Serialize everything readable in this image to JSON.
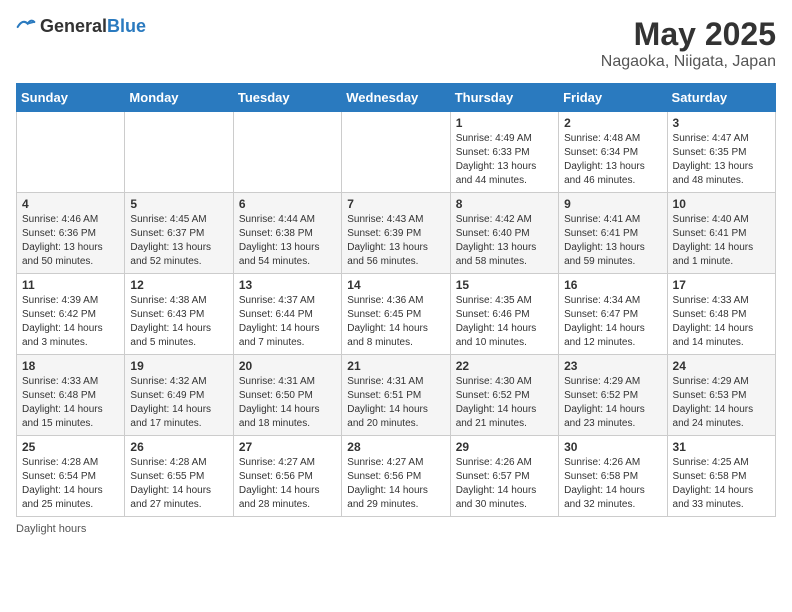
{
  "header": {
    "logo_general": "General",
    "logo_blue": "Blue",
    "month_title": "May 2025",
    "location": "Nagaoka, Niigata, Japan"
  },
  "weekdays": [
    "Sunday",
    "Monday",
    "Tuesday",
    "Wednesday",
    "Thursday",
    "Friday",
    "Saturday"
  ],
  "weeks": [
    [
      {
        "day": "",
        "info": ""
      },
      {
        "day": "",
        "info": ""
      },
      {
        "day": "",
        "info": ""
      },
      {
        "day": "",
        "info": ""
      },
      {
        "day": "1",
        "info": "Sunrise: 4:49 AM\nSunset: 6:33 PM\nDaylight: 13 hours\nand 44 minutes."
      },
      {
        "day": "2",
        "info": "Sunrise: 4:48 AM\nSunset: 6:34 PM\nDaylight: 13 hours\nand 46 minutes."
      },
      {
        "day": "3",
        "info": "Sunrise: 4:47 AM\nSunset: 6:35 PM\nDaylight: 13 hours\nand 48 minutes."
      }
    ],
    [
      {
        "day": "4",
        "info": "Sunrise: 4:46 AM\nSunset: 6:36 PM\nDaylight: 13 hours\nand 50 minutes."
      },
      {
        "day": "5",
        "info": "Sunrise: 4:45 AM\nSunset: 6:37 PM\nDaylight: 13 hours\nand 52 minutes."
      },
      {
        "day": "6",
        "info": "Sunrise: 4:44 AM\nSunset: 6:38 PM\nDaylight: 13 hours\nand 54 minutes."
      },
      {
        "day": "7",
        "info": "Sunrise: 4:43 AM\nSunset: 6:39 PM\nDaylight: 13 hours\nand 56 minutes."
      },
      {
        "day": "8",
        "info": "Sunrise: 4:42 AM\nSunset: 6:40 PM\nDaylight: 13 hours\nand 58 minutes."
      },
      {
        "day": "9",
        "info": "Sunrise: 4:41 AM\nSunset: 6:41 PM\nDaylight: 13 hours\nand 59 minutes."
      },
      {
        "day": "10",
        "info": "Sunrise: 4:40 AM\nSunset: 6:41 PM\nDaylight: 14 hours\nand 1 minute."
      }
    ],
    [
      {
        "day": "11",
        "info": "Sunrise: 4:39 AM\nSunset: 6:42 PM\nDaylight: 14 hours\nand 3 minutes."
      },
      {
        "day": "12",
        "info": "Sunrise: 4:38 AM\nSunset: 6:43 PM\nDaylight: 14 hours\nand 5 minutes."
      },
      {
        "day": "13",
        "info": "Sunrise: 4:37 AM\nSunset: 6:44 PM\nDaylight: 14 hours\nand 7 minutes."
      },
      {
        "day": "14",
        "info": "Sunrise: 4:36 AM\nSunset: 6:45 PM\nDaylight: 14 hours\nand 8 minutes."
      },
      {
        "day": "15",
        "info": "Sunrise: 4:35 AM\nSunset: 6:46 PM\nDaylight: 14 hours\nand 10 minutes."
      },
      {
        "day": "16",
        "info": "Sunrise: 4:34 AM\nSunset: 6:47 PM\nDaylight: 14 hours\nand 12 minutes."
      },
      {
        "day": "17",
        "info": "Sunrise: 4:33 AM\nSunset: 6:48 PM\nDaylight: 14 hours\nand 14 minutes."
      }
    ],
    [
      {
        "day": "18",
        "info": "Sunrise: 4:33 AM\nSunset: 6:48 PM\nDaylight: 14 hours\nand 15 minutes."
      },
      {
        "day": "19",
        "info": "Sunrise: 4:32 AM\nSunset: 6:49 PM\nDaylight: 14 hours\nand 17 minutes."
      },
      {
        "day": "20",
        "info": "Sunrise: 4:31 AM\nSunset: 6:50 PM\nDaylight: 14 hours\nand 18 minutes."
      },
      {
        "day": "21",
        "info": "Sunrise: 4:31 AM\nSunset: 6:51 PM\nDaylight: 14 hours\nand 20 minutes."
      },
      {
        "day": "22",
        "info": "Sunrise: 4:30 AM\nSunset: 6:52 PM\nDaylight: 14 hours\nand 21 minutes."
      },
      {
        "day": "23",
        "info": "Sunrise: 4:29 AM\nSunset: 6:52 PM\nDaylight: 14 hours\nand 23 minutes."
      },
      {
        "day": "24",
        "info": "Sunrise: 4:29 AM\nSunset: 6:53 PM\nDaylight: 14 hours\nand 24 minutes."
      }
    ],
    [
      {
        "day": "25",
        "info": "Sunrise: 4:28 AM\nSunset: 6:54 PM\nDaylight: 14 hours\nand 25 minutes."
      },
      {
        "day": "26",
        "info": "Sunrise: 4:28 AM\nSunset: 6:55 PM\nDaylight: 14 hours\nand 27 minutes."
      },
      {
        "day": "27",
        "info": "Sunrise: 4:27 AM\nSunset: 6:56 PM\nDaylight: 14 hours\nand 28 minutes."
      },
      {
        "day": "28",
        "info": "Sunrise: 4:27 AM\nSunset: 6:56 PM\nDaylight: 14 hours\nand 29 minutes."
      },
      {
        "day": "29",
        "info": "Sunrise: 4:26 AM\nSunset: 6:57 PM\nDaylight: 14 hours\nand 30 minutes."
      },
      {
        "day": "30",
        "info": "Sunrise: 4:26 AM\nSunset: 6:58 PM\nDaylight: 14 hours\nand 32 minutes."
      },
      {
        "day": "31",
        "info": "Sunrise: 4:25 AM\nSunset: 6:58 PM\nDaylight: 14 hours\nand 33 minutes."
      }
    ]
  ],
  "footer": {
    "note": "Daylight hours"
  }
}
